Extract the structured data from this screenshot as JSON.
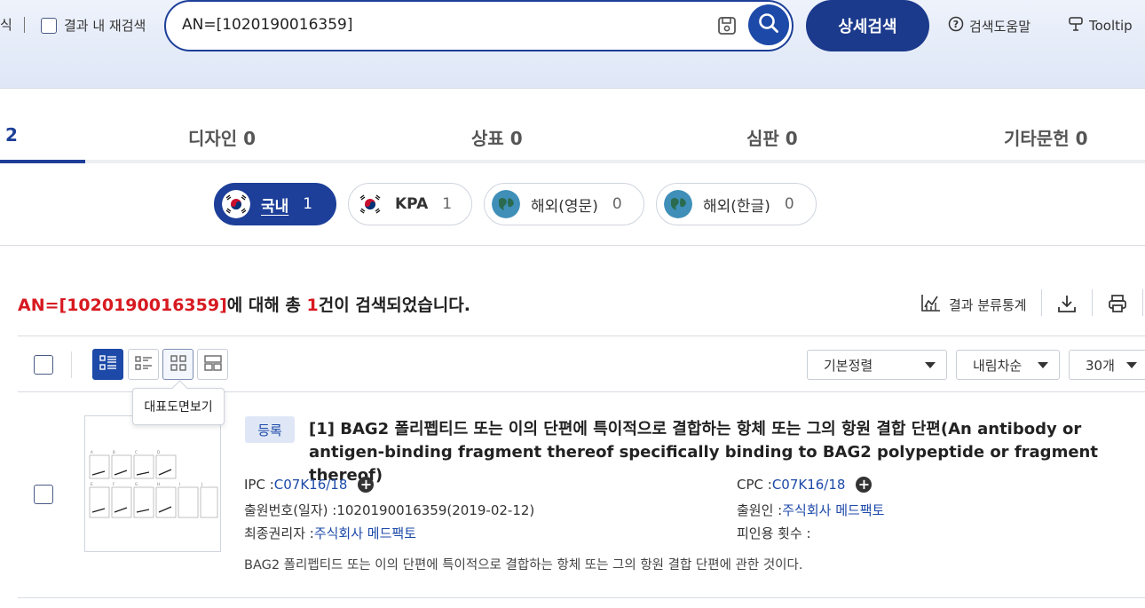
{
  "header": {
    "left_cut_text": "식",
    "re_search_label": "결과 내 재검색",
    "search_query": "AN=[1020190016359]",
    "advanced_search_label": "상세검색",
    "help_label": "검색도움말",
    "tooltip_label": "Tooltip"
  },
  "tabs": [
    {
      "label": "2"
    },
    {
      "label": "디자인 0"
    },
    {
      "label": "상표 0"
    },
    {
      "label": "심판 0"
    },
    {
      "label": "기타문헌 0"
    }
  ],
  "regions": [
    {
      "label": "국내",
      "count": "1"
    },
    {
      "label": "KPA",
      "count": "1"
    },
    {
      "label": "해외(영문)",
      "count": "0"
    },
    {
      "label": "해외(한글)",
      "count": "0"
    }
  ],
  "summary": {
    "query": "AN=[1020190016359]",
    "mid": "에 대해 총 ",
    "count": "1",
    "tail": "건이 검색되었습니다."
  },
  "actions": {
    "stats_label": "결과 분류통계"
  },
  "toolbar": {
    "sort_value": "기본정렬",
    "order_value": "내림차순",
    "page_size_value": "30개",
    "view_tooltip": "대표도면보기"
  },
  "result": {
    "status": "등록",
    "title": "[1] BAG2 폴리펩티드 또는 이의 단편에 특이적으로 결합하는 항체 또는 그의 항원 결합 단편(An antibody or antigen-binding fragment thereof specifically binding to BAG2 polypeptide or fragment thereof)",
    "ipc_label": "IPC : ",
    "ipc_value": "C07K16/18",
    "cpc_label": "CPC : ",
    "cpc_value": "C07K16/18",
    "appno_label": "출원번호(일자) : ",
    "appno_value": "1020190016359(2019-02-12)",
    "applicant_label": "출원인 : ",
    "applicant_value": "주식회사 메드팩토",
    "holder_label": "최종권리자 : ",
    "holder_value": "주식회사 메드팩토",
    "cited_label": "피인용 횟수 : ",
    "abstract": "BAG2 폴리펩티드 또는 이의 단편에 특이적으로 결합하는 항체 또는 그의 항원 결합 단편에 관한 것이다."
  },
  "colors": {
    "brand": "#1d3f99",
    "highlight": "#d71920",
    "link": "#1d4aa8"
  }
}
